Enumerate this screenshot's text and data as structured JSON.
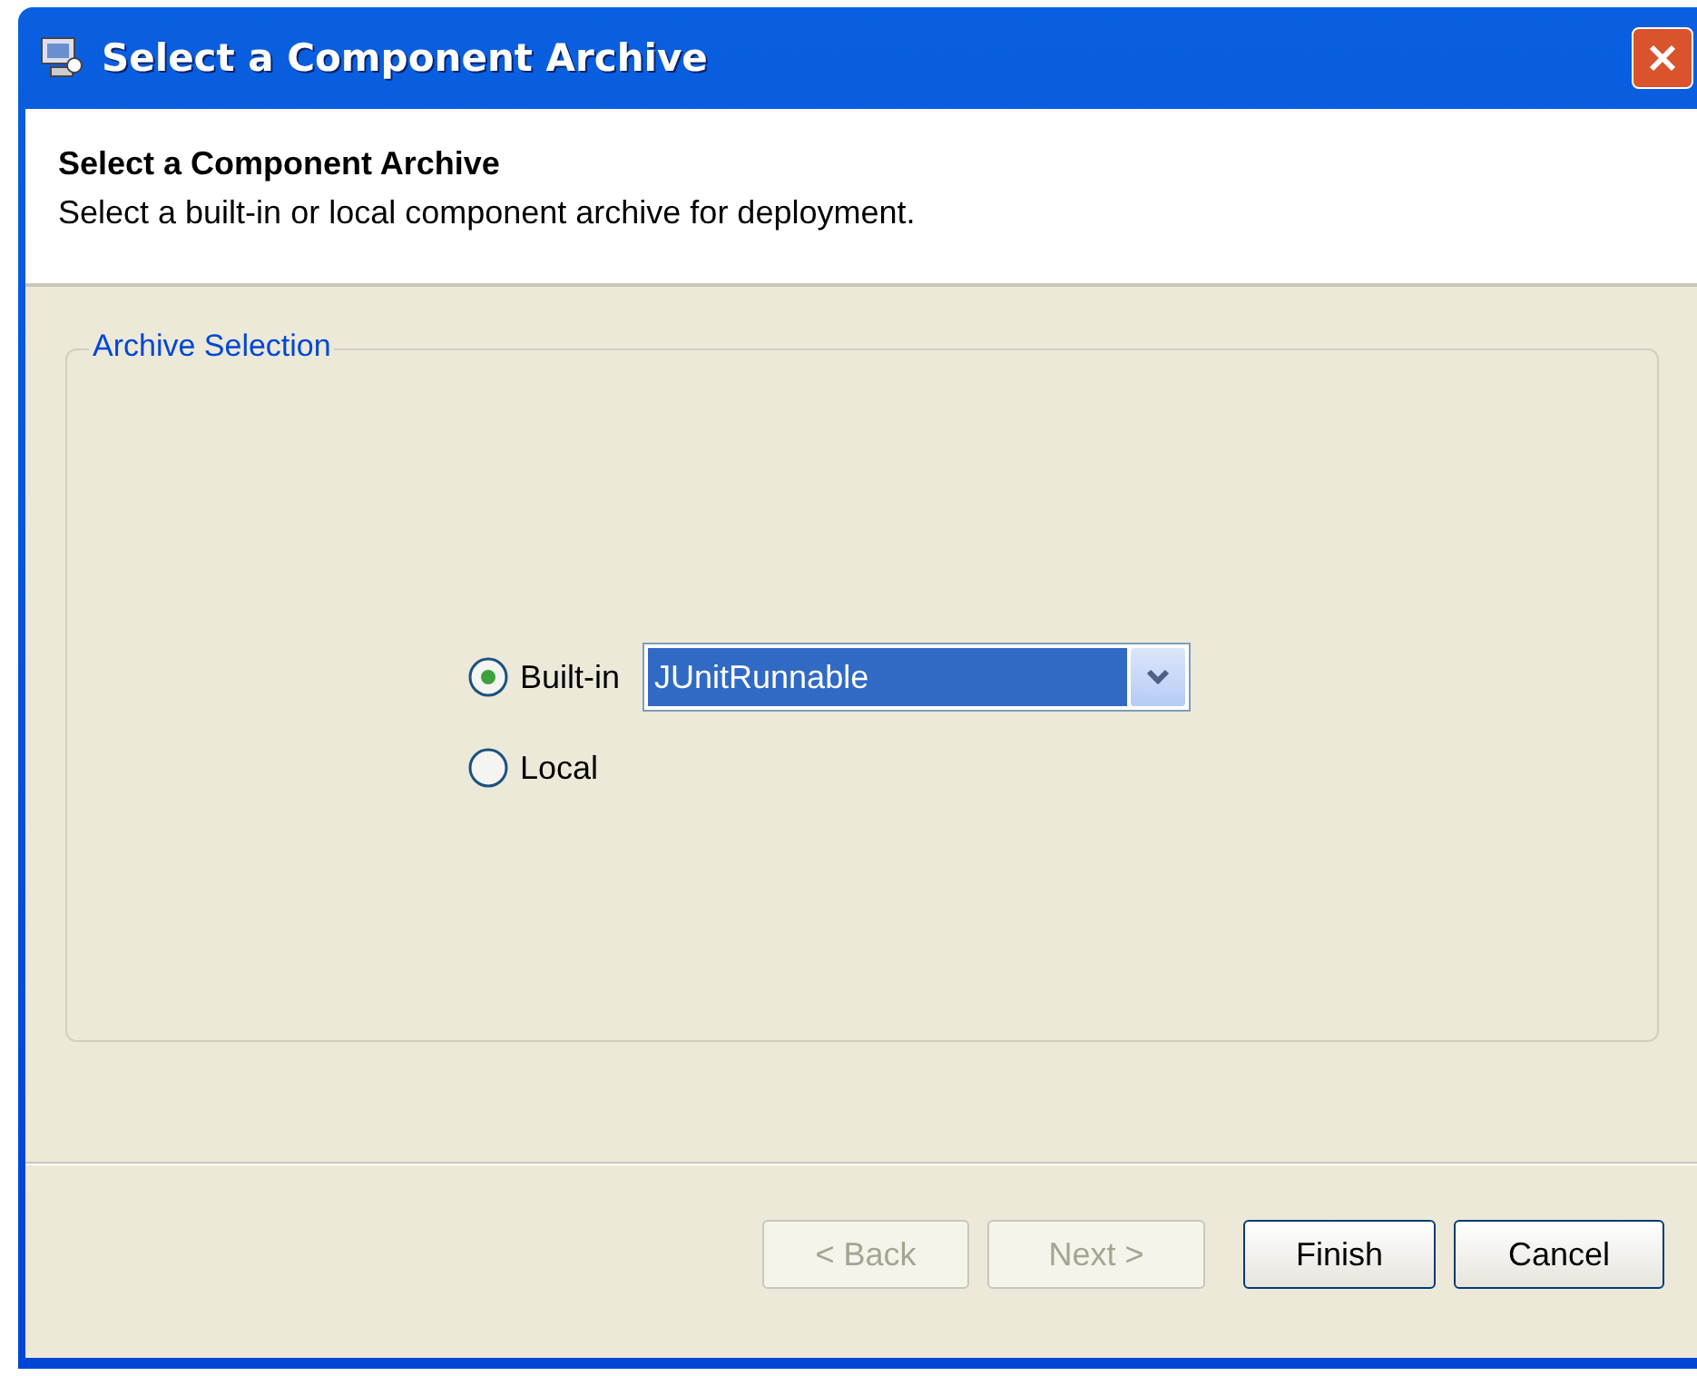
{
  "window": {
    "title": "Select a Component Archive"
  },
  "header": {
    "title": "Select a Component Archive",
    "subtitle": "Select a built-in or local component archive for deployment."
  },
  "group": {
    "title": "Archive Selection"
  },
  "options": [
    {
      "label": "Built-in",
      "selected": true
    },
    {
      "label": "Local",
      "selected": false
    }
  ],
  "archive_dropdown": {
    "value": "JUnitRunnable"
  },
  "buttons": [
    {
      "label": "< Back",
      "disabled": true
    },
    {
      "label": "Next >",
      "disabled": true
    },
    {
      "label": "Finish",
      "disabled": false
    },
    {
      "label": "Cancel",
      "disabled": false
    }
  ]
}
